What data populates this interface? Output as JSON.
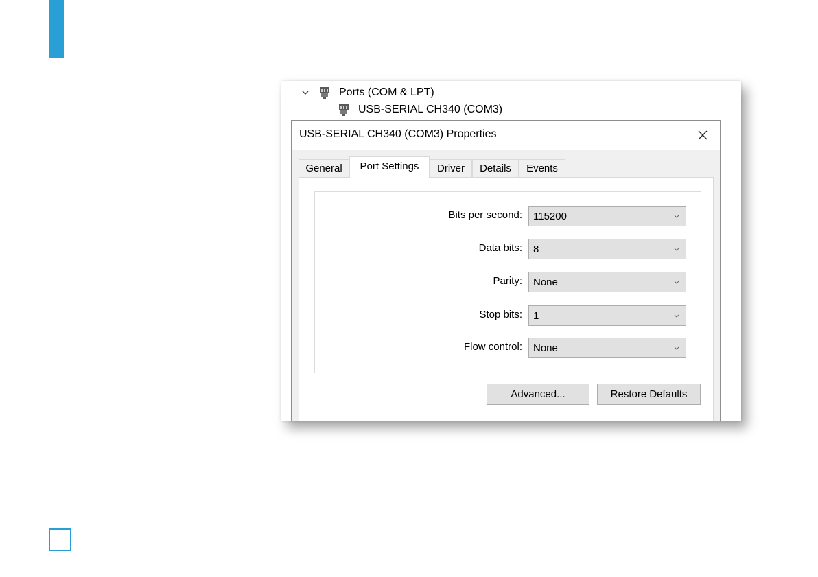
{
  "tree": {
    "ports_label": "Ports (COM & LPT)",
    "device_label": "USB-SERIAL CH340 (COM3)"
  },
  "dialog": {
    "title": "USB-SERIAL CH340 (COM3) Properties",
    "tabs": [
      "General",
      "Port Settings",
      "Driver",
      "Details",
      "Events"
    ],
    "active_tab": "Port Settings",
    "settings": [
      {
        "label": "Bits per second:",
        "value": "115200"
      },
      {
        "label": "Data bits:",
        "value": "8"
      },
      {
        "label": "Parity:",
        "value": "None"
      },
      {
        "label": "Stop bits:",
        "value": "1"
      },
      {
        "label": "Flow control:",
        "value": "None"
      }
    ],
    "advanced_label": "Advanced...",
    "restore_label": "Restore Defaults"
  },
  "icons": {
    "expand": "chevron-down-icon",
    "port": "port-connector-icon",
    "close": "close-icon",
    "dropdown": "chevron-down-icon"
  },
  "colors": {
    "accent": "#2a9fd6"
  }
}
